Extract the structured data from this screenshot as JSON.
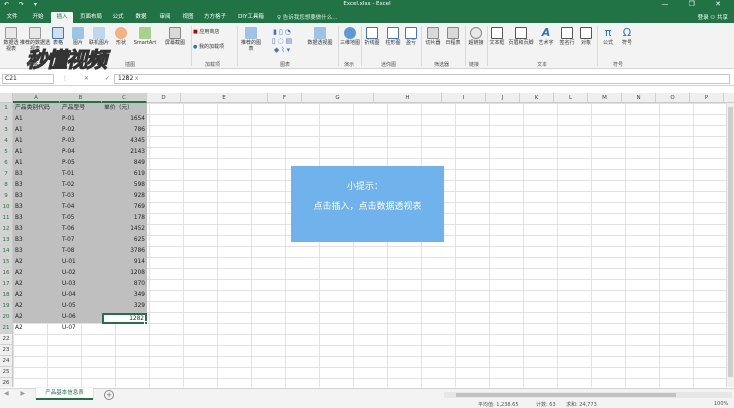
{
  "window": {
    "title": "Excel.xlsx - Excel",
    "quick_access": "↶ ↷ ▾",
    "controls": "— ❐ ✕"
  },
  "tabs": [
    "文件",
    "开始",
    "插入",
    "页面布局",
    "公式",
    "数据",
    "审阅",
    "视图",
    "方方格子",
    "DIY工具箱"
  ],
  "active_tab": "插入",
  "tell_me": "♀ 告诉我您想要做什么...",
  "user": "登录  ⚇ 共享",
  "ribbon": {
    "watermark": "秒懂视频",
    "buttons": {
      "pivot_table": "数据透视表",
      "recommended_pivot": "推荐的数据透视表",
      "table": "表格",
      "pictures": "图片",
      "online_pictures": "联机图片",
      "shapes": "形状",
      "smartart": "SmartArt",
      "screenshot": "屏幕截图",
      "store": "应用商店",
      "my_addins": "我的加载项",
      "recommended_charts": "推荐的图表",
      "pivot_chart": "数据透视图",
      "map3d": "三维地图",
      "line": "折线图",
      "column": "柱形图",
      "winloss": "盈亏",
      "slicer": "切片器",
      "timeline": "日程表",
      "hyperlink": "超链接",
      "textbox": "文本框",
      "header_footer": "页眉和页脚",
      "wordart": "艺术字",
      "signature": "签名行",
      "object": "对象",
      "equation": "公式",
      "symbol": "符号"
    },
    "groups": {
      "tables": "表格",
      "illustrations": "插图",
      "addins": "加载项",
      "charts": "图表",
      "tours": "演示",
      "sparklines": "迷你图",
      "filters": "筛选器",
      "links": "链接",
      "text": "文本",
      "symbols": "符号"
    }
  },
  "formula_bar": {
    "name_box": "C21",
    "icons": "⋮ ✕ ✓ fx",
    "value": "1282"
  },
  "columns": [
    "A",
    "B",
    "C",
    "D",
    "E",
    "F",
    "G",
    "H",
    "I",
    "J",
    "K",
    "L",
    "M",
    "N",
    "O",
    "P",
    "Q"
  ],
  "rows": [
    "1",
    "2",
    "3",
    "4",
    "5",
    "6",
    "7",
    "8",
    "9",
    "10",
    "11",
    "12",
    "13",
    "14",
    "15",
    "16",
    "17",
    "18",
    "19",
    "20",
    "21",
    "22",
    "23",
    "24",
    "25",
    "26"
  ],
  "sheet": {
    "header": [
      "产品类别代码",
      "产品型号",
      "单价（元）"
    ],
    "data": [
      [
        "A1",
        "P-01",
        "1654"
      ],
      [
        "A1",
        "P-02",
        "786"
      ],
      [
        "A1",
        "P-03",
        "4345"
      ],
      [
        "A1",
        "P-04",
        "2143"
      ],
      [
        "A1",
        "P-05",
        "849"
      ],
      [
        "B3",
        "T-01",
        "619"
      ],
      [
        "B3",
        "T-02",
        "598"
      ],
      [
        "B3",
        "T-03",
        "928"
      ],
      [
        "B3",
        "T-04",
        "769"
      ],
      [
        "B3",
        "T-05",
        "178"
      ],
      [
        "B3",
        "T-06",
        "1452"
      ],
      [
        "B3",
        "T-07",
        "625"
      ],
      [
        "B3",
        "T-08",
        "3786"
      ],
      [
        "A2",
        "U-01",
        "914"
      ],
      [
        "A2",
        "U-02",
        "1208"
      ],
      [
        "A2",
        "U-03",
        "870"
      ],
      [
        "A2",
        "U-04",
        "349"
      ],
      [
        "A2",
        "U-05",
        "329"
      ],
      [
        "A2",
        "U-06",
        "489"
      ],
      [
        "A2",
        "U-07",
        "1282"
      ]
    ]
  },
  "tip": {
    "title": "小提示：",
    "body": "点击插入，点击数据透视表"
  },
  "sheet_tab": "产品基本信息表",
  "sheet_nav": "◀ ▶",
  "add_sheet": "+",
  "status": {
    "average": "平均值: 1,238.65",
    "count": "计数: 63",
    "sum": "求和: 24,773",
    "zoom": "100%"
  }
}
